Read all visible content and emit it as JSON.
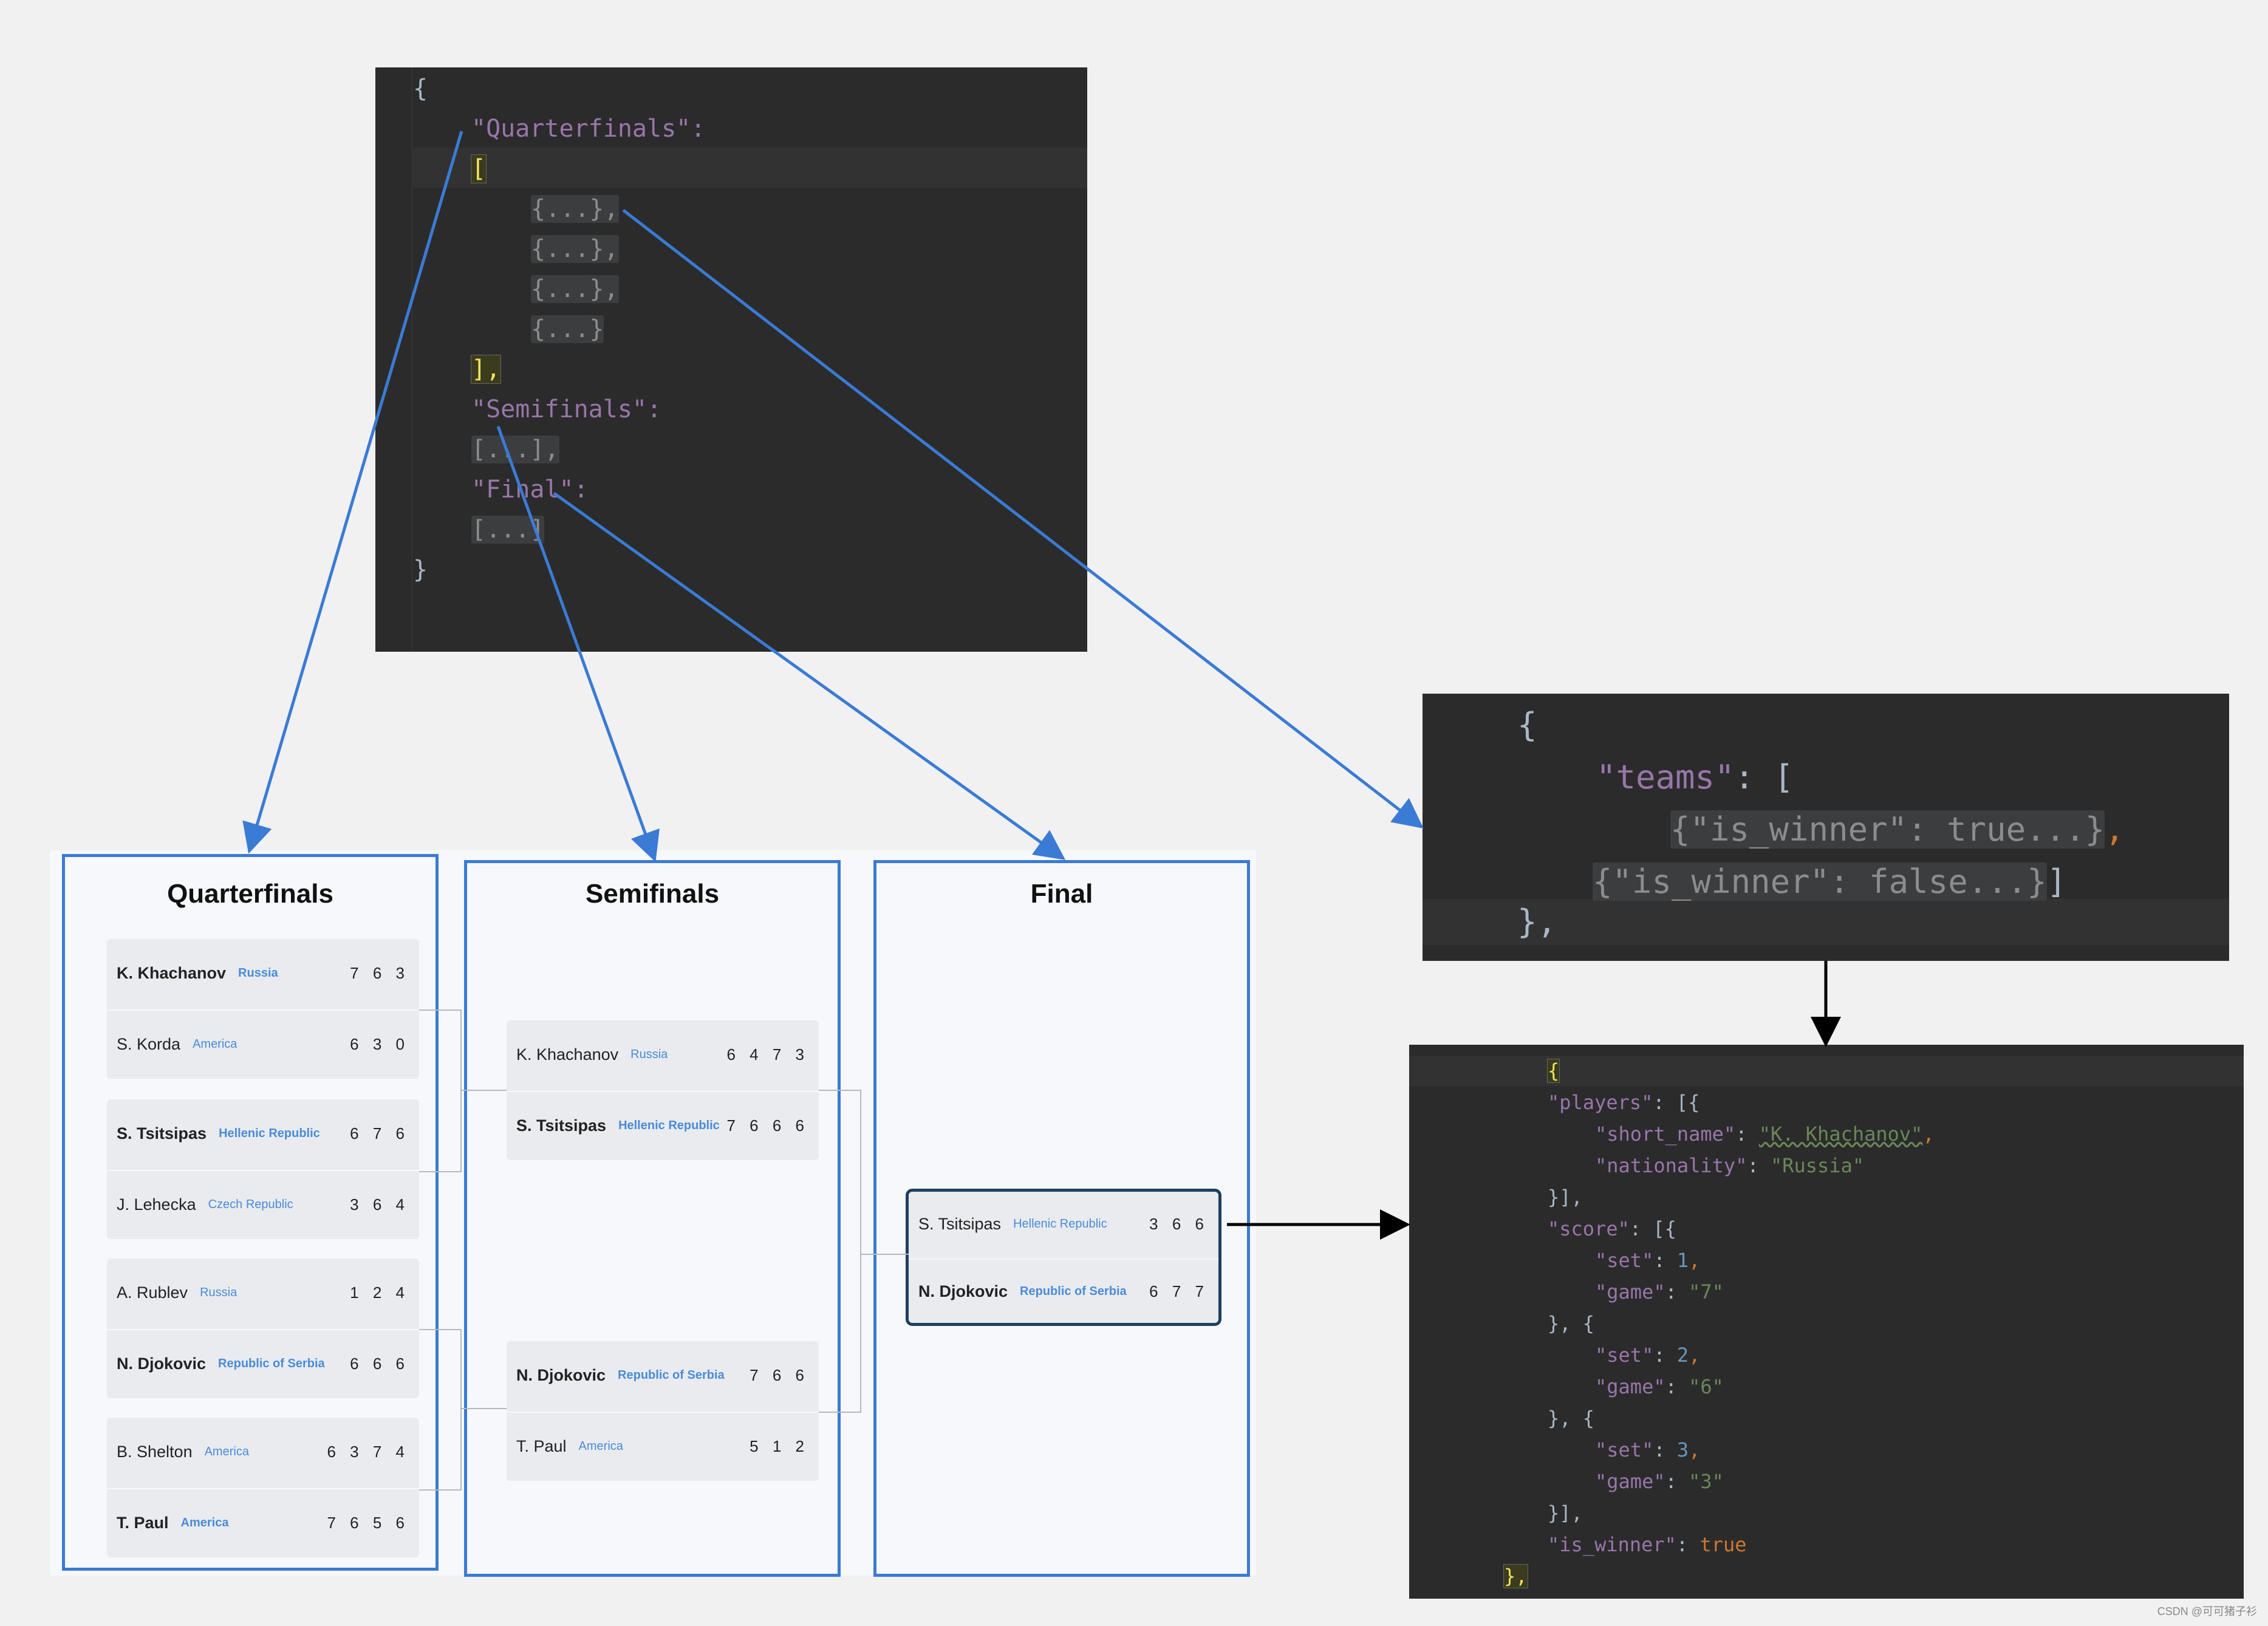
{
  "json_editor": {
    "lines": [
      {
        "t": "{"
      },
      {
        "t": "\"Quarterfinals\":"
      },
      {
        "t": "["
      },
      {
        "t": "{...},"
      },
      {
        "t": "{...},"
      },
      {
        "t": "{...},"
      },
      {
        "t": "{...}"
      },
      {
        "t": "],"
      },
      {
        "t": "\"Semifinals\":"
      },
      {
        "t": "[...],"
      },
      {
        "t": "\"Final\":"
      },
      {
        "t": "[...]"
      },
      {
        "t": "}"
      }
    ]
  },
  "match_snippet": {
    "open": "{",
    "teams_key": "\"teams\"",
    "winner_true": "{\"is_winner\": true...}",
    "winner_false": "{\"is_winner\": false...}",
    "close": "},"
  },
  "team_detail": {
    "open": "{",
    "players_key": "\"players\"",
    "short_name_key": "\"short_name\"",
    "short_name_val": "\"K. Khachanov\"",
    "nationality_key": "\"nationality\"",
    "nationality_val": "\"Russia\"",
    "players_close": "}],",
    "score_key": "\"score\"",
    "set_key": "\"set\"",
    "game_key": "\"game\"",
    "sets": [
      {
        "set": "1",
        "game": "\"7\""
      },
      {
        "set": "2",
        "game": "\"6\""
      },
      {
        "set": "3",
        "game": "\"3\""
      }
    ],
    "score_close": "}],",
    "is_winner_key": "\"is_winner\"",
    "is_winner_val": "true",
    "close": "},"
  },
  "bracket": {
    "rounds": [
      {
        "title": "Quarterfinals",
        "matches": [
          {
            "rows": [
              {
                "name": "K. Khachanov",
                "nat": "Russia",
                "score": "7 6 3",
                "winner": true
              },
              {
                "name": "S. Korda",
                "nat": "America",
                "score": "6 3 0",
                "winner": false
              }
            ]
          },
          {
            "rows": [
              {
                "name": "S. Tsitsipas",
                "nat": "Hellenic Republic",
                "score": "6 7 6",
                "winner": true
              },
              {
                "name": "J. Lehecka",
                "nat": "Czech Republic",
                "score": "3 6 4",
                "winner": false
              }
            ]
          },
          {
            "rows": [
              {
                "name": "A. Rublev",
                "nat": "Russia",
                "score": "1 2 4",
                "winner": false
              },
              {
                "name": "N. Djokovic",
                "nat": "Republic of Serbia",
                "score": "6 6 6",
                "winner": true
              }
            ]
          },
          {
            "rows": [
              {
                "name": "B. Shelton",
                "nat": "America",
                "score": "6 3 7 4",
                "winner": false
              },
              {
                "name": "T. Paul",
                "nat": "America",
                "score": "7 6 5 6",
                "winner": true
              }
            ]
          }
        ]
      },
      {
        "title": "Semifinals",
        "matches": [
          {
            "rows": [
              {
                "name": "K. Khachanov",
                "nat": "Russia",
                "score": "6 4 7 3",
                "winner": false
              },
              {
                "name": "S. Tsitsipas",
                "nat": "Hellenic Republic",
                "score": "7 6 6 6",
                "winner": true
              }
            ]
          },
          {
            "rows": [
              {
                "name": "N. Djokovic",
                "nat": "Republic of Serbia",
                "score": "7 6 6",
                "winner": true
              },
              {
                "name": "T. Paul",
                "nat": "America",
                "score": "5 1 2",
                "winner": false
              }
            ]
          }
        ]
      },
      {
        "title": "Final",
        "matches": [
          {
            "rows": [
              {
                "name": "S. Tsitsipas",
                "nat": "Hellenic Republic",
                "score": "3 6 6",
                "winner": false
              },
              {
                "name": "N. Djokovic",
                "nat": "Republic of Serbia",
                "score": "6 7 7",
                "winner": true
              }
            ]
          }
        ]
      }
    ]
  },
  "watermark": "CSDN @可可猪子衫",
  "colors": {
    "arrow_blue": "#3a7bd5",
    "arrow_black": "#000000",
    "frame_blue": "#3a7bd5"
  }
}
